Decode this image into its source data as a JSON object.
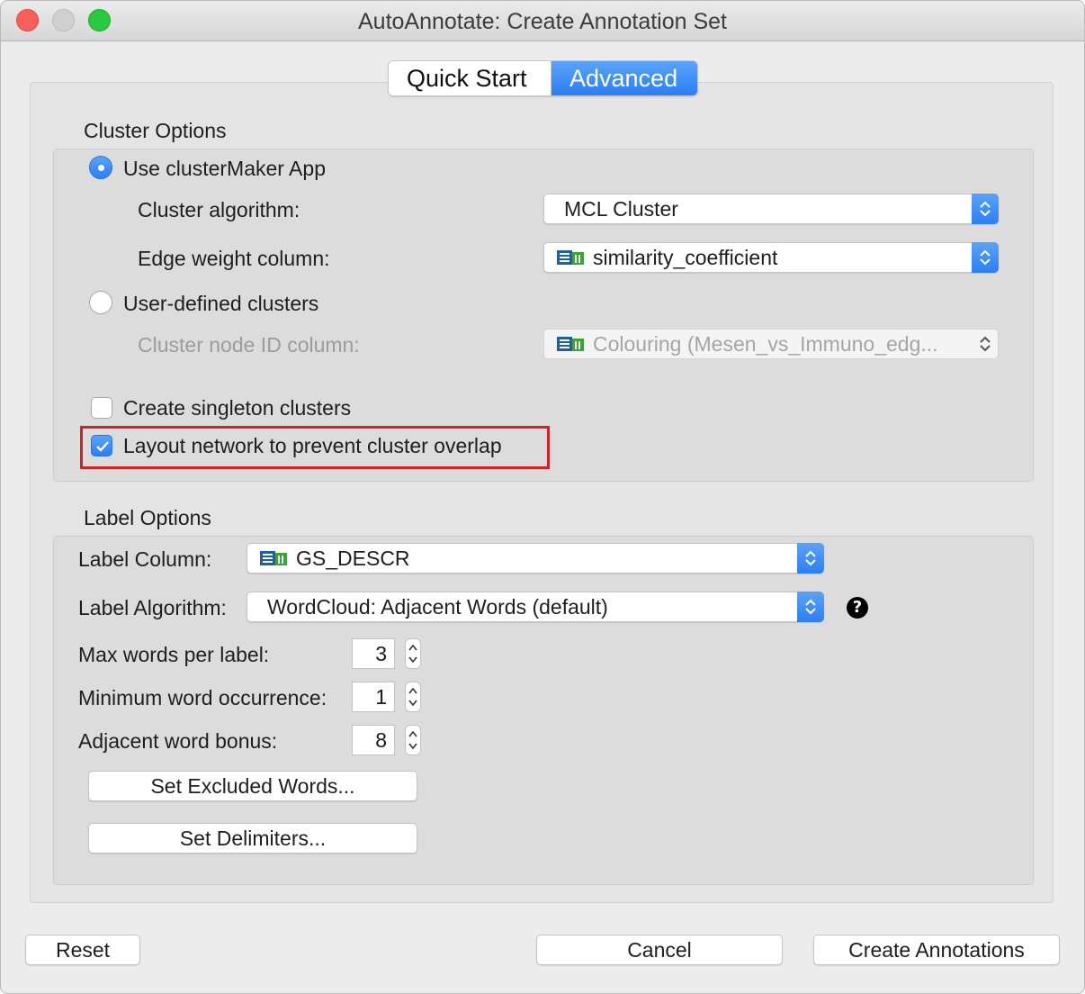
{
  "window": {
    "title": "AutoAnnotate: Create Annotation Set"
  },
  "tabs": [
    {
      "label": "Quick Start",
      "selected": false
    },
    {
      "label": "Advanced",
      "selected": true
    }
  ],
  "cluster_options": {
    "heading": "Cluster Options",
    "use_clustermaker": {
      "label": "Use clusterMaker App",
      "selected": true
    },
    "cluster_algorithm": {
      "label": "Cluster algorithm:",
      "value": "MCL Cluster"
    },
    "edge_weight_column": {
      "label": "Edge weight column:",
      "value": "similarity_coefficient",
      "icon": "table-column-icon"
    },
    "user_defined": {
      "label": "User-defined clusters",
      "selected": false
    },
    "cluster_node_id_column": {
      "label": "Cluster node ID column:",
      "value": "Colouring (Mesen_vs_Immuno_edg...",
      "enabled": false,
      "icon": "table-column-icon"
    },
    "create_singleton": {
      "label": "Create singleton clusters",
      "checked": false
    },
    "layout_network": {
      "label": "Layout network to prevent cluster overlap",
      "checked": true,
      "highlight_color": "#d71f26"
    }
  },
  "label_options": {
    "heading": "Label Options",
    "label_column": {
      "label": "Label Column:",
      "value": "GS_DESCR",
      "icon": "table-column-icon"
    },
    "label_algorithm": {
      "label": "Label Algorithm:",
      "value": "WordCloud: Adjacent Words (default)",
      "help_icon": "?"
    },
    "max_words": {
      "label": "Max words per label:",
      "value": "3"
    },
    "min_word_occurrence": {
      "label": "Minimum word occurrence:",
      "value": "1"
    },
    "adjacent_word_bonus": {
      "label": "Adjacent word bonus:",
      "value": "8"
    },
    "set_excluded_words": "Set Excluded Words...",
    "set_delimiters": "Set Delimiters..."
  },
  "footer": {
    "reset": "Reset",
    "cancel": "Cancel",
    "create": "Create Annotations"
  },
  "colors": {
    "accent": "#2b7ff5",
    "close": "#fc5f57",
    "maximize": "#29c940"
  }
}
